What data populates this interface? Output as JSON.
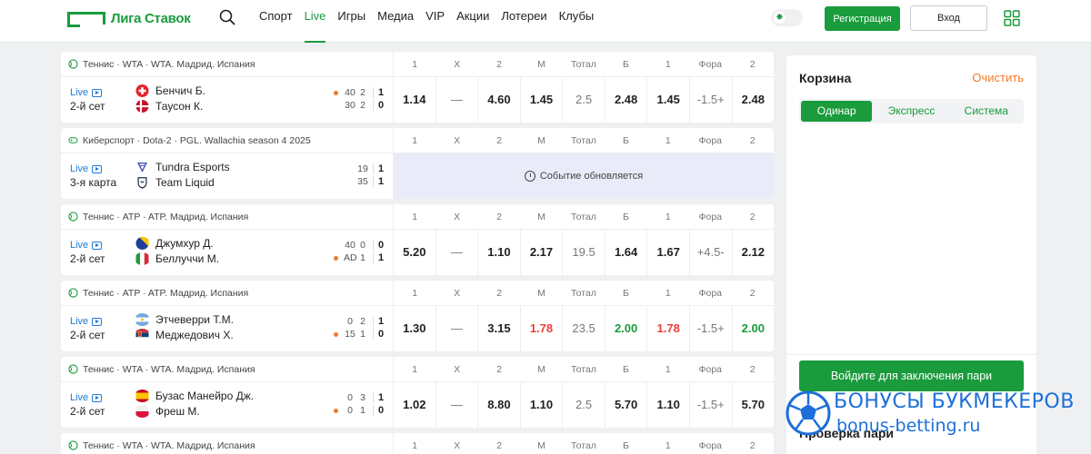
{
  "header": {
    "logo_text": "Лига Ставок",
    "nav": [
      "Спорт",
      "Live",
      "Игры",
      "Медиа",
      "VIP",
      "Акции",
      "Лотереи",
      "Клубы"
    ],
    "active_nav": "Live",
    "register_label": "Регистрация",
    "login_label": "Вход"
  },
  "columns": [
    "1",
    "X",
    "2",
    "М",
    "Тотал",
    "Б",
    "1",
    "Фора",
    "2"
  ],
  "events": [
    {
      "league": "Теннис · WTA · WTA. Мадрид. Испания",
      "live": "Live",
      "period": "2-й сет",
      "team1": "Бенчич Б.",
      "team2": "Таусон К.",
      "score1": [
        "40",
        "2",
        "1"
      ],
      "score2": [
        "30",
        "2",
        "0"
      ],
      "odds": [
        "1.14",
        "—",
        "4.60",
        "1.45",
        "2.5",
        "2.48",
        "1.45",
        "-1.5+",
        "2.48"
      ]
    },
    {
      "league": "Киберспорт · Dota-2 · PGL. Wallachia season 4 2025",
      "live": "Live",
      "period": "3-я карта",
      "team1": "Tundra Esports",
      "team2": "Team Liquid",
      "score1": [
        "19",
        "1"
      ],
      "score2": [
        "35",
        "1"
      ],
      "updating": "Событие обновляется"
    },
    {
      "league": "Теннис · ATP · ATP. Мадрид. Испания",
      "live": "Live",
      "period": "2-й сет",
      "team1": "Джумхур Д.",
      "team2": "Беллуччи М.",
      "score1": [
        "40",
        "0",
        "0"
      ],
      "score2": [
        "AD",
        "1",
        "1"
      ],
      "odds": [
        "5.20",
        "—",
        "1.10",
        "2.17",
        "19.5",
        "1.64",
        "1.67",
        "+4.5-",
        "2.12"
      ]
    },
    {
      "league": "Теннис · ATP · ATP. Мадрид. Испания",
      "live": "Live",
      "period": "2-й сет",
      "team1": "Этчеверри Т.М.",
      "team2": "Меджедович Х.",
      "score1": [
        "0",
        "2",
        "1"
      ],
      "score2": [
        "15",
        "1",
        "0"
      ],
      "odds": [
        "1.30",
        "—",
        "3.15",
        "1.78",
        "23.5",
        "2.00",
        "1.78",
        "-1.5+",
        "2.00"
      ]
    },
    {
      "league": "Теннис · WTA · WTA. Мадрид. Испания",
      "live": "Live",
      "period": "2-й сет",
      "team1": "Бузас Манейро Дж.",
      "team2": "Фреш М.",
      "score1": [
        "0",
        "3",
        "1"
      ],
      "score2": [
        "0",
        "1",
        "0"
      ],
      "odds": [
        "1.02",
        "—",
        "8.80",
        "1.10",
        "2.5",
        "5.70",
        "1.10",
        "-1.5+",
        "5.70"
      ]
    },
    {
      "league": "Теннис · WTA · WTA. Мадрид. Испания"
    }
  ],
  "coupon": {
    "title": "Корзина",
    "clear": "Очистить",
    "tabs": [
      "Одинар",
      "Экспресс",
      "Система"
    ],
    "place_bet": "Войдите для заключения пари",
    "check_bet": "Проверка пари"
  },
  "watermark": {
    "line1": "БОНУСЫ БУКМЕКЕРОВ",
    "line2": "bonus-betting.ru"
  },
  "colors": {
    "brand": "#1a9b3c",
    "accent_orange": "#f07a2a",
    "odd_down": "#e8413a",
    "odd_up": "#1a9b3c",
    "live_blue": "#1e7ad6"
  }
}
